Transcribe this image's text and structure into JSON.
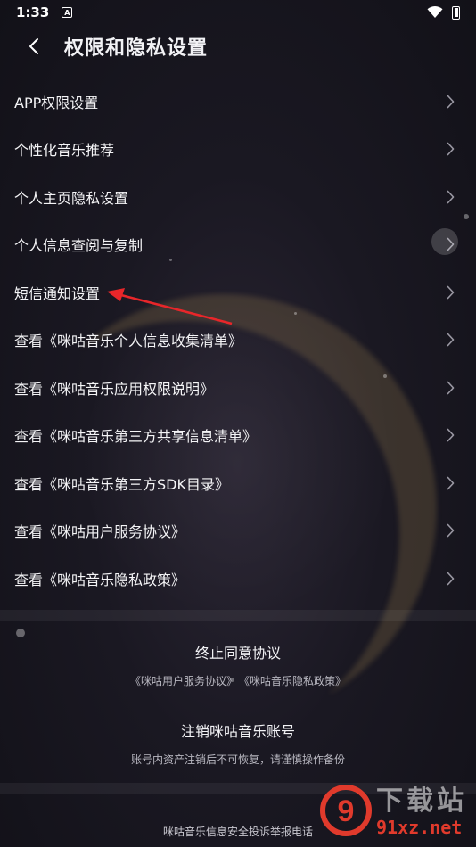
{
  "status_bar": {
    "time": "1:33",
    "notification_glyph": "A",
    "icons": [
      "wifi-icon",
      "battery-icon"
    ]
  },
  "header": {
    "back_icon": "chevron-left-icon",
    "title": "权限和隐私设置"
  },
  "menu": {
    "items": [
      {
        "label": "APP权限设置"
      },
      {
        "label": "个性化音乐推荐"
      },
      {
        "label": "个人主页隐私设置"
      },
      {
        "label": "个人信息查阅与复制"
      },
      {
        "label": "短信通知设置"
      },
      {
        "label": "查看《咪咕音乐个人信息收集清单》"
      },
      {
        "label": "查看《咪咕音乐应用权限说明》"
      },
      {
        "label": "查看《咪咕音乐第三方共享信息清单》"
      },
      {
        "label": "查看《咪咕音乐第三方SDK目录》"
      },
      {
        "label": "查看《咪咕用户服务协议》"
      },
      {
        "label": "查看《咪咕音乐隐私政策》"
      }
    ],
    "chevron_icon": "chevron-right-icon"
  },
  "terminate": {
    "title": "终止同意协议",
    "link_service": "《咪咕用户服务协议》",
    "link_privacy": "《咪咕音乐隐私政策》"
  },
  "cancel_account": {
    "title": "注销咪咕音乐账号",
    "note": "账号内资产注销后不可恢复，请谨慎操作备份"
  },
  "footer": {
    "text": "咪咕音乐信息安全投诉举报电话"
  },
  "watermark": {
    "top": "下载站",
    "bottom": "91xz.net",
    "logo_glyph": "9"
  },
  "colors": {
    "background": "#17151f",
    "text": "#f2f2f5",
    "subtext": "#b8b7c0",
    "annotation_arrow": "#e8262a",
    "watermark_red": "#e03a2c"
  }
}
